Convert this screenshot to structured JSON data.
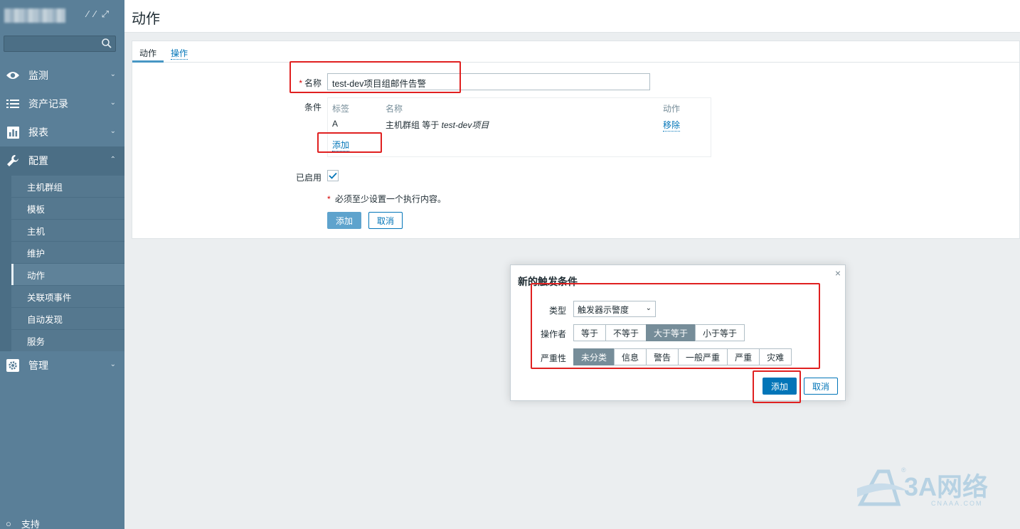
{
  "sidebar": {
    "search_placeholder": "",
    "nav": [
      {
        "label": "监测",
        "icon": "eye-icon"
      },
      {
        "label": "资产记录",
        "icon": "list-icon"
      },
      {
        "label": "报表",
        "icon": "bar-chart-icon"
      },
      {
        "label": "配置",
        "icon": "wrench-icon"
      },
      {
        "label": "管理",
        "icon": "gear-icon"
      }
    ],
    "sub": [
      "主机群组",
      "模板",
      "主机",
      "维护",
      "动作",
      "关联项事件",
      "自动发现",
      "服务"
    ],
    "current_sub": "动作",
    "support": "支持"
  },
  "page": {
    "title": "动作",
    "tabs": [
      "动作",
      "操作"
    ]
  },
  "form": {
    "name_label": "名称",
    "name_value": "test-dev项目组邮件告警",
    "conditions_label": "条件",
    "conditions": {
      "headers": [
        "标签",
        "名称",
        "动作"
      ],
      "rows": [
        {
          "tag": "A",
          "name_prefix": "主机群组 等于 ",
          "name_value": "test-dev项目",
          "action": "移除"
        }
      ],
      "add_link": "添加"
    },
    "enabled_label": "已启用",
    "enabled": true,
    "note_star": "*",
    "note": " 必须至少设置一个执行内容。",
    "add_button": "添加",
    "cancel_button": "取消"
  },
  "dialog": {
    "title": "新的触发条件",
    "close": "×",
    "type_label": "类型",
    "type_value": "触发器示警度",
    "operator_label": "操作者",
    "operators": [
      "等于",
      "不等于",
      "大于等于",
      "小于等于"
    ],
    "operator_selected": 2,
    "severity_label": "严重性",
    "severities": [
      "未分类",
      "信息",
      "警告",
      "一般严重",
      "严重",
      "灾难"
    ],
    "severity_selected": 0,
    "add_button": "添加",
    "cancel_button": "取消"
  },
  "watermark": {
    "brand": "3A网络",
    "sub": "CNAAA.COM"
  },
  "colors": {
    "sidebar": "#5a7f98",
    "accent": "#0275b8",
    "highlight": "#e02020"
  }
}
